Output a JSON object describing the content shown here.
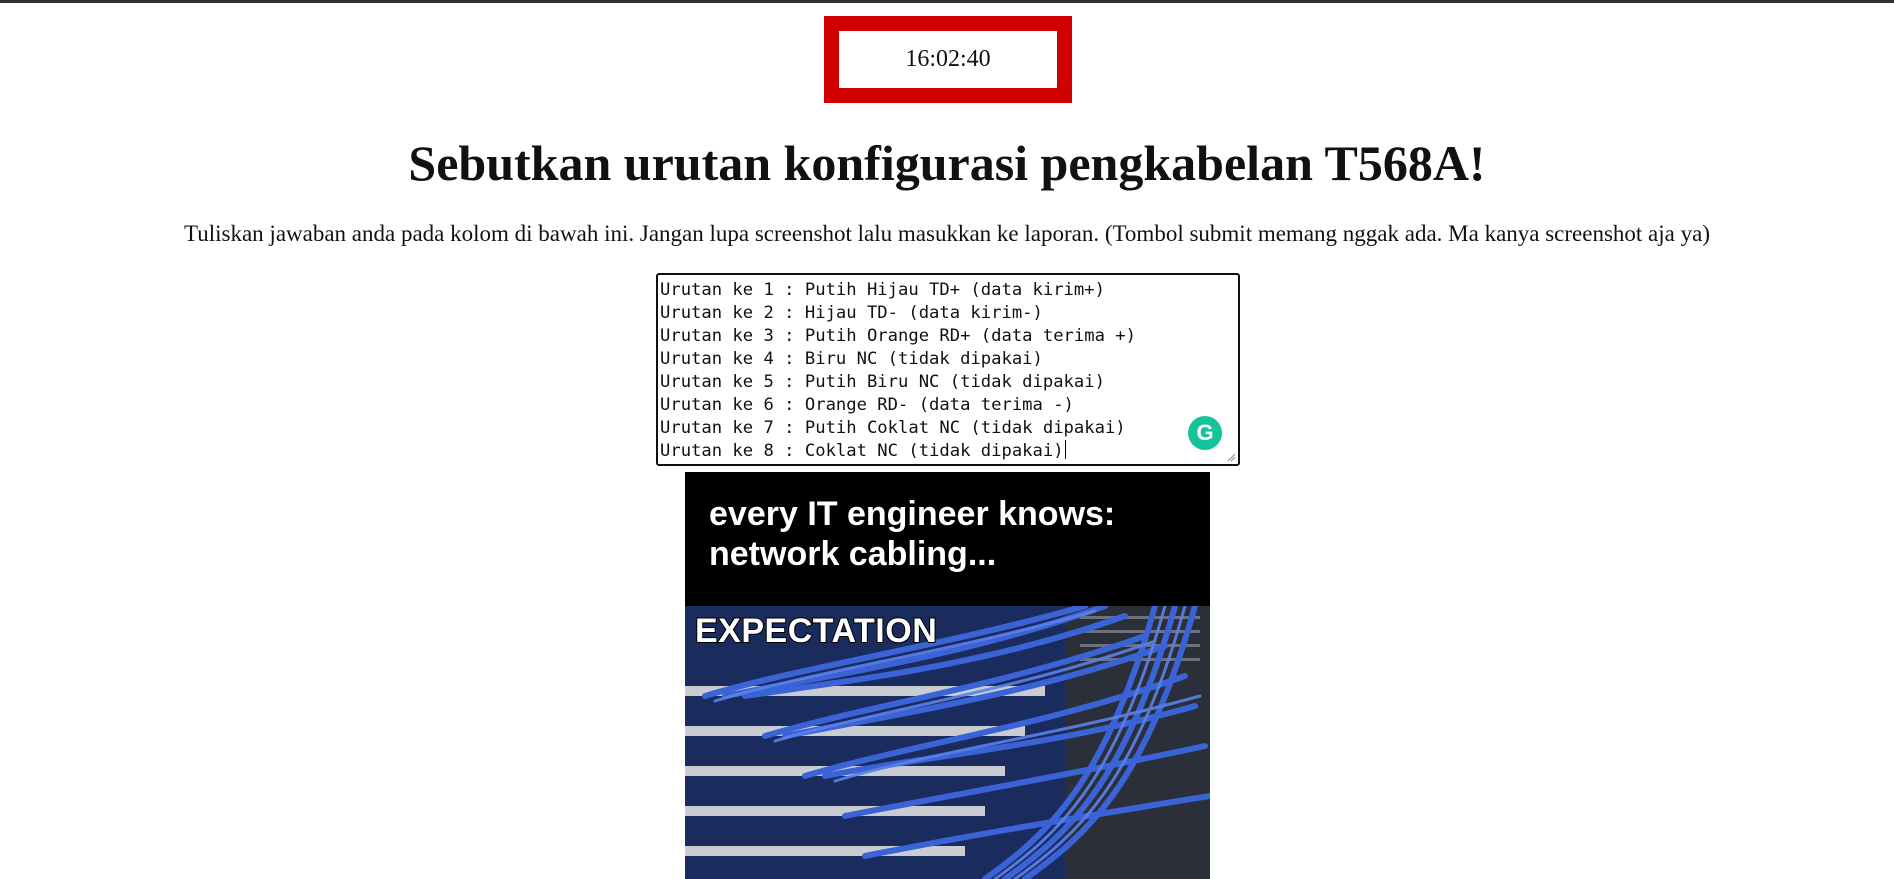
{
  "timer": {
    "value": "16:02:40"
  },
  "question": {
    "title": "Sebutkan urutan konfigurasi pengkabelan T568A!",
    "instruction": "Tuliskan jawaban anda pada kolom di bawah ini. Jangan lupa screenshot lalu masukkan ke laporan. (Tombol submit memang nggak ada. Ma kanya screenshot aja ya)"
  },
  "answer": {
    "lines": [
      "Urutan ke 1 : Putih Hijau TD+ (data kirim+)",
      "Urutan ke 2 : Hijau TD- (data kirim-)",
      "Urutan ke 3 : Putih Orange RD+ (data terima +)",
      "Urutan ke 4 : Biru NC (tidak dipakai)",
      "Urutan ke 5 : Putih Biru NC (tidak dipakai)",
      "Urutan ke 6 : Orange RD- (data terima -)",
      "Urutan ke 7 : Putih Coklat NC (tidak dipakai)",
      "Urutan ke 8 : Coklat NC (tidak dipakai)"
    ],
    "assistant_icon": "grammarly-icon",
    "assistant_glyph": "G"
  },
  "meme": {
    "caption_line1": "every IT engineer knows:",
    "caption_line2": "network cabling...",
    "panel_label": "EXPECTATION"
  },
  "colors": {
    "timer_border": "#d10000",
    "assistant": "#15c39a",
    "cable_blue": "#3a63d6"
  }
}
